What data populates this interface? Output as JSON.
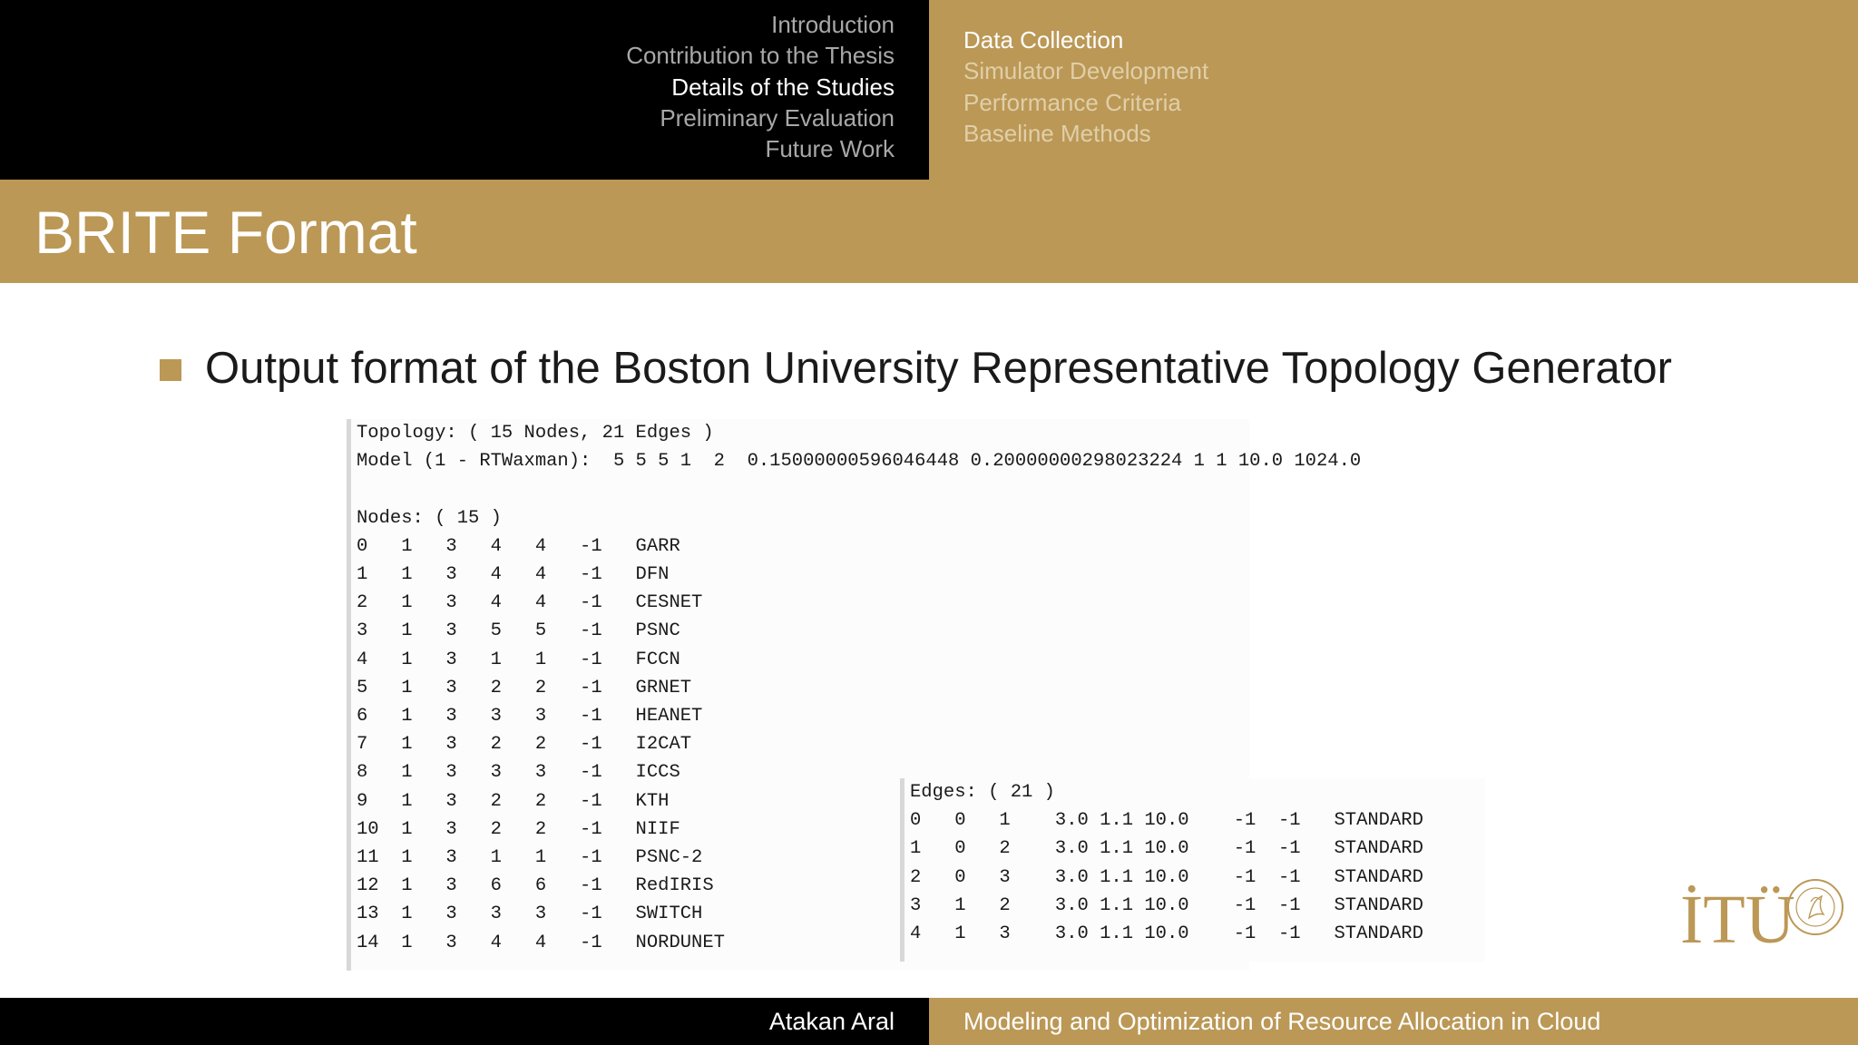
{
  "nav": {
    "sections": [
      {
        "label": "Introduction",
        "active": false
      },
      {
        "label": "Contribution to the Thesis",
        "active": false
      },
      {
        "label": "Details of the Studies",
        "active": true
      },
      {
        "label": "Preliminary Evaluation",
        "active": false
      },
      {
        "label": "Future Work",
        "active": false
      }
    ],
    "subsections": [
      {
        "label": "Data Collection",
        "active": true
      },
      {
        "label": "Simulator Development",
        "active": false
      },
      {
        "label": "Performance Criteria",
        "active": false
      },
      {
        "label": "Baseline Methods",
        "active": false
      }
    ]
  },
  "slide": {
    "title": "BRITE Format",
    "bullet": "Output format of the Boston University Representative Topology Generator"
  },
  "brite": {
    "topology_line": "Topology: ( 15 Nodes, 21 Edges )",
    "model_line": "Model (1 - RTWaxman):  5 5 5 1  2  0.1500000059604 6448 0.20000000298023224 1 1 10.0 1024.0",
    "nodes_header": "Nodes: ( 15 )",
    "nodes": [
      [
        "0",
        "1",
        "3",
        "4",
        "4",
        "-1",
        "GARR"
      ],
      [
        "1",
        "1",
        "3",
        "4",
        "4",
        "-1",
        "DFN"
      ],
      [
        "2",
        "1",
        "3",
        "4",
        "4",
        "-1",
        "CESNET"
      ],
      [
        "3",
        "1",
        "3",
        "5",
        "5",
        "-1",
        "PSNC"
      ],
      [
        "4",
        "1",
        "3",
        "1",
        "1",
        "-1",
        "FCCN"
      ],
      [
        "5",
        "1",
        "3",
        "2",
        "2",
        "-1",
        "GRNET"
      ],
      [
        "6",
        "1",
        "3",
        "3",
        "3",
        "-1",
        "HEANET"
      ],
      [
        "7",
        "1",
        "3",
        "2",
        "2",
        "-1",
        "I2CAT"
      ],
      [
        "8",
        "1",
        "3",
        "3",
        "3",
        "-1",
        "ICCS"
      ],
      [
        "9",
        "1",
        "3",
        "2",
        "2",
        "-1",
        "KTH"
      ],
      [
        "10",
        "1",
        "3",
        "2",
        "2",
        "-1",
        "NIIF"
      ],
      [
        "11",
        "1",
        "3",
        "1",
        "1",
        "-1",
        "PSNC-2"
      ],
      [
        "12",
        "1",
        "3",
        "6",
        "6",
        "-1",
        "RedIRIS"
      ],
      [
        "13",
        "1",
        "3",
        "3",
        "3",
        "-1",
        "SWITCH"
      ],
      [
        "14",
        "1",
        "3",
        "4",
        "4",
        "-1",
        "NORDUNET"
      ]
    ],
    "edges_header": "Edges: ( 21 )",
    "edges": [
      [
        "0",
        "0",
        "1",
        "3.0",
        "1.1",
        "10.0",
        "-1",
        "-1",
        "STANDARD"
      ],
      [
        "1",
        "0",
        "2",
        "3.0",
        "1.1",
        "10.0",
        "-1",
        "-1",
        "STANDARD"
      ],
      [
        "2",
        "0",
        "3",
        "3.0",
        "1.1",
        "10.0",
        "-1",
        "-1",
        "STANDARD"
      ],
      [
        "3",
        "1",
        "2",
        "3.0",
        "1.1",
        "10.0",
        "-1",
        "-1",
        "STANDARD"
      ],
      [
        "4",
        "1",
        "3",
        "3.0",
        "1.1",
        "10.0",
        "-1",
        "-1",
        "STANDARD"
      ]
    ]
  },
  "logo": {
    "text": "İTÜ",
    "seal_text": "İSTANBUL TEKNİK ÜNİVERSİTESİ 1773"
  },
  "footer": {
    "author": "Atakan Aral",
    "talk_title": "Modeling and Optimization of Resource Allocation in Cloud"
  },
  "colors": {
    "gold": "#bb9856",
    "black": "#000000",
    "inactive_nav": "#a8a8a8",
    "inactive_subnav": "#e0cfa8"
  }
}
